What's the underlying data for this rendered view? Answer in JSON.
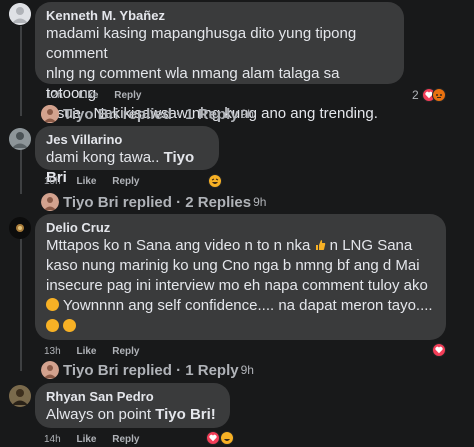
{
  "comments": [
    {
      "author": "Kenneth M. Ybañez",
      "lines": [
        "madami kasing mapanghusga dito yung tipong comment",
        "nlng ng comment wla nmang alam talaga sa totoong",
        "issue . Nakikisawsaw nlng kung ano ang trending."
      ],
      "time": "12h",
      "like": "Like",
      "reply": "Reply",
      "reaction_count": "2",
      "replies_text": "Tiyo Bri replied · 1 Reply",
      "replies_time": "9h",
      "colors": {
        "love": "#f33e58",
        "haha": "#f7b125"
      }
    },
    {
      "author": "Jes Villarino",
      "text_before": "dami kong tawa.. ",
      "tag": "Tiyo Bri",
      "time": "10h",
      "like": "Like",
      "reply": "Reply",
      "replies_text": "Tiyo Bri replied · 2 Replies",
      "replies_time": "9h"
    },
    {
      "author": "Delio Cruz",
      "line1_before": "Mttapos ko n Sana ang video n to n nka ",
      "line1_after": " n LNG Sana",
      "line2": "kaso nung marinig ko ung Cno nga b nmng bf ang d Mai",
      "line3": "insecure pag ini interview mo eh napa comment tuloy ako",
      "line4": " Yownnnn ang self confidence.... na dapat meron tayo....",
      "time": "13h",
      "like": "Like",
      "reply": "Reply",
      "replies_text": "Tiyo Bri replied · 1 Reply",
      "replies_time": "9h"
    },
    {
      "author": "Rhyan San Pedro",
      "text_before": "Always on point ",
      "tag": "Tiyo Bri!",
      "time": "14h",
      "like": "Like",
      "reply": "Reply"
    }
  ]
}
